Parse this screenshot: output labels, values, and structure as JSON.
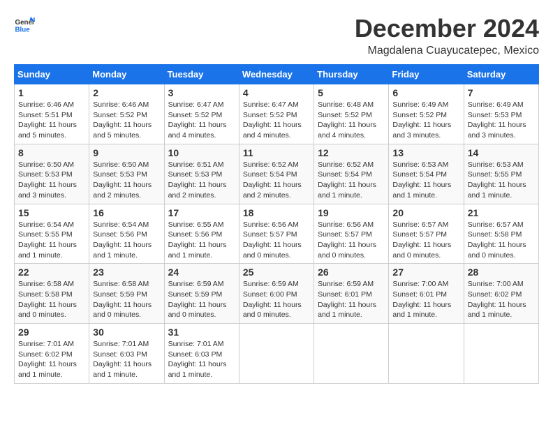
{
  "header": {
    "logo_line1": "General",
    "logo_line2": "Blue",
    "month": "December 2024",
    "location": "Magdalena Cuayucatepec, Mexico"
  },
  "weekdays": [
    "Sunday",
    "Monday",
    "Tuesday",
    "Wednesday",
    "Thursday",
    "Friday",
    "Saturday"
  ],
  "weeks": [
    [
      {
        "day": "1",
        "info": "Sunrise: 6:46 AM\nSunset: 5:51 PM\nDaylight: 11 hours\nand 5 minutes."
      },
      {
        "day": "2",
        "info": "Sunrise: 6:46 AM\nSunset: 5:52 PM\nDaylight: 11 hours\nand 5 minutes."
      },
      {
        "day": "3",
        "info": "Sunrise: 6:47 AM\nSunset: 5:52 PM\nDaylight: 11 hours\nand 4 minutes."
      },
      {
        "day": "4",
        "info": "Sunrise: 6:47 AM\nSunset: 5:52 PM\nDaylight: 11 hours\nand 4 minutes."
      },
      {
        "day": "5",
        "info": "Sunrise: 6:48 AM\nSunset: 5:52 PM\nDaylight: 11 hours\nand 4 minutes."
      },
      {
        "day": "6",
        "info": "Sunrise: 6:49 AM\nSunset: 5:52 PM\nDaylight: 11 hours\nand 3 minutes."
      },
      {
        "day": "7",
        "info": "Sunrise: 6:49 AM\nSunset: 5:53 PM\nDaylight: 11 hours\nand 3 minutes."
      }
    ],
    [
      {
        "day": "8",
        "info": "Sunrise: 6:50 AM\nSunset: 5:53 PM\nDaylight: 11 hours\nand 3 minutes."
      },
      {
        "day": "9",
        "info": "Sunrise: 6:50 AM\nSunset: 5:53 PM\nDaylight: 11 hours\nand 2 minutes."
      },
      {
        "day": "10",
        "info": "Sunrise: 6:51 AM\nSunset: 5:53 PM\nDaylight: 11 hours\nand 2 minutes."
      },
      {
        "day": "11",
        "info": "Sunrise: 6:52 AM\nSunset: 5:54 PM\nDaylight: 11 hours\nand 2 minutes."
      },
      {
        "day": "12",
        "info": "Sunrise: 6:52 AM\nSunset: 5:54 PM\nDaylight: 11 hours\nand 1 minute."
      },
      {
        "day": "13",
        "info": "Sunrise: 6:53 AM\nSunset: 5:54 PM\nDaylight: 11 hours\nand 1 minute."
      },
      {
        "day": "14",
        "info": "Sunrise: 6:53 AM\nSunset: 5:55 PM\nDaylight: 11 hours\nand 1 minute."
      }
    ],
    [
      {
        "day": "15",
        "info": "Sunrise: 6:54 AM\nSunset: 5:55 PM\nDaylight: 11 hours\nand 1 minute."
      },
      {
        "day": "16",
        "info": "Sunrise: 6:54 AM\nSunset: 5:56 PM\nDaylight: 11 hours\nand 1 minute."
      },
      {
        "day": "17",
        "info": "Sunrise: 6:55 AM\nSunset: 5:56 PM\nDaylight: 11 hours\nand 1 minute."
      },
      {
        "day": "18",
        "info": "Sunrise: 6:56 AM\nSunset: 5:57 PM\nDaylight: 11 hours\nand 0 minutes."
      },
      {
        "day": "19",
        "info": "Sunrise: 6:56 AM\nSunset: 5:57 PM\nDaylight: 11 hours\nand 0 minutes."
      },
      {
        "day": "20",
        "info": "Sunrise: 6:57 AM\nSunset: 5:57 PM\nDaylight: 11 hours\nand 0 minutes."
      },
      {
        "day": "21",
        "info": "Sunrise: 6:57 AM\nSunset: 5:58 PM\nDaylight: 11 hours\nand 0 minutes."
      }
    ],
    [
      {
        "day": "22",
        "info": "Sunrise: 6:58 AM\nSunset: 5:58 PM\nDaylight: 11 hours\nand 0 minutes."
      },
      {
        "day": "23",
        "info": "Sunrise: 6:58 AM\nSunset: 5:59 PM\nDaylight: 11 hours\nand 0 minutes."
      },
      {
        "day": "24",
        "info": "Sunrise: 6:59 AM\nSunset: 5:59 PM\nDaylight: 11 hours\nand 0 minutes."
      },
      {
        "day": "25",
        "info": "Sunrise: 6:59 AM\nSunset: 6:00 PM\nDaylight: 11 hours\nand 0 minutes."
      },
      {
        "day": "26",
        "info": "Sunrise: 6:59 AM\nSunset: 6:01 PM\nDaylight: 11 hours\nand 1 minute."
      },
      {
        "day": "27",
        "info": "Sunrise: 7:00 AM\nSunset: 6:01 PM\nDaylight: 11 hours\nand 1 minute."
      },
      {
        "day": "28",
        "info": "Sunrise: 7:00 AM\nSunset: 6:02 PM\nDaylight: 11 hours\nand 1 minute."
      }
    ],
    [
      {
        "day": "29",
        "info": "Sunrise: 7:01 AM\nSunset: 6:02 PM\nDaylight: 11 hours\nand 1 minute."
      },
      {
        "day": "30",
        "info": "Sunrise: 7:01 AM\nSunset: 6:03 PM\nDaylight: 11 hours\nand 1 minute."
      },
      {
        "day": "31",
        "info": "Sunrise: 7:01 AM\nSunset: 6:03 PM\nDaylight: 11 hours\nand 1 minute."
      },
      {
        "day": "",
        "info": ""
      },
      {
        "day": "",
        "info": ""
      },
      {
        "day": "",
        "info": ""
      },
      {
        "day": "",
        "info": ""
      }
    ]
  ]
}
